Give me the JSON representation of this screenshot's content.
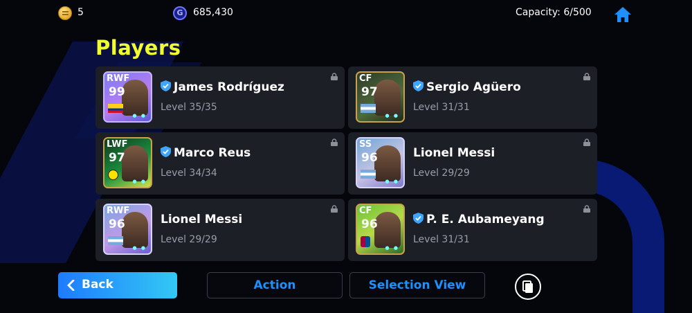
{
  "topbar": {
    "coins": "5",
    "gp": "685,430",
    "gp_symbol": "G",
    "capacity": "Capacity: 6/500"
  },
  "page_title": "Players",
  "players": [
    {
      "position": "RWF",
      "rating": "99",
      "name": "James Rodríguez",
      "level": "Level 35/35",
      "verified": true,
      "flag": "colombia"
    },
    {
      "position": "CF",
      "rating": "97",
      "name": "Sergio Agüero",
      "level": "Level 31/31",
      "verified": true,
      "flag": "argentina"
    },
    {
      "position": "LWF",
      "rating": "97",
      "name": "Marco Reus",
      "level": "Level 34/34",
      "verified": true,
      "flag": "bvb"
    },
    {
      "position": "SS",
      "rating": "96",
      "name": "Lionel Messi",
      "level": "Level 29/29",
      "verified": false,
      "flag": "argentina"
    },
    {
      "position": "RWF",
      "rating": "96",
      "name": "Lionel Messi",
      "level": "Level 29/29",
      "verified": false,
      "flag": "argentina"
    },
    {
      "position": "CF",
      "rating": "96",
      "name": "P. E. Aubameyang",
      "level": "Level 31/31",
      "verified": true,
      "flag": "fcb"
    }
  ],
  "buttons": {
    "back": "Back",
    "action": "Action",
    "selection_view": "Selection View"
  },
  "colors": {
    "title": "#f1ff2f",
    "accent": "#1e90ff",
    "card_bg": "#1d1f27"
  }
}
